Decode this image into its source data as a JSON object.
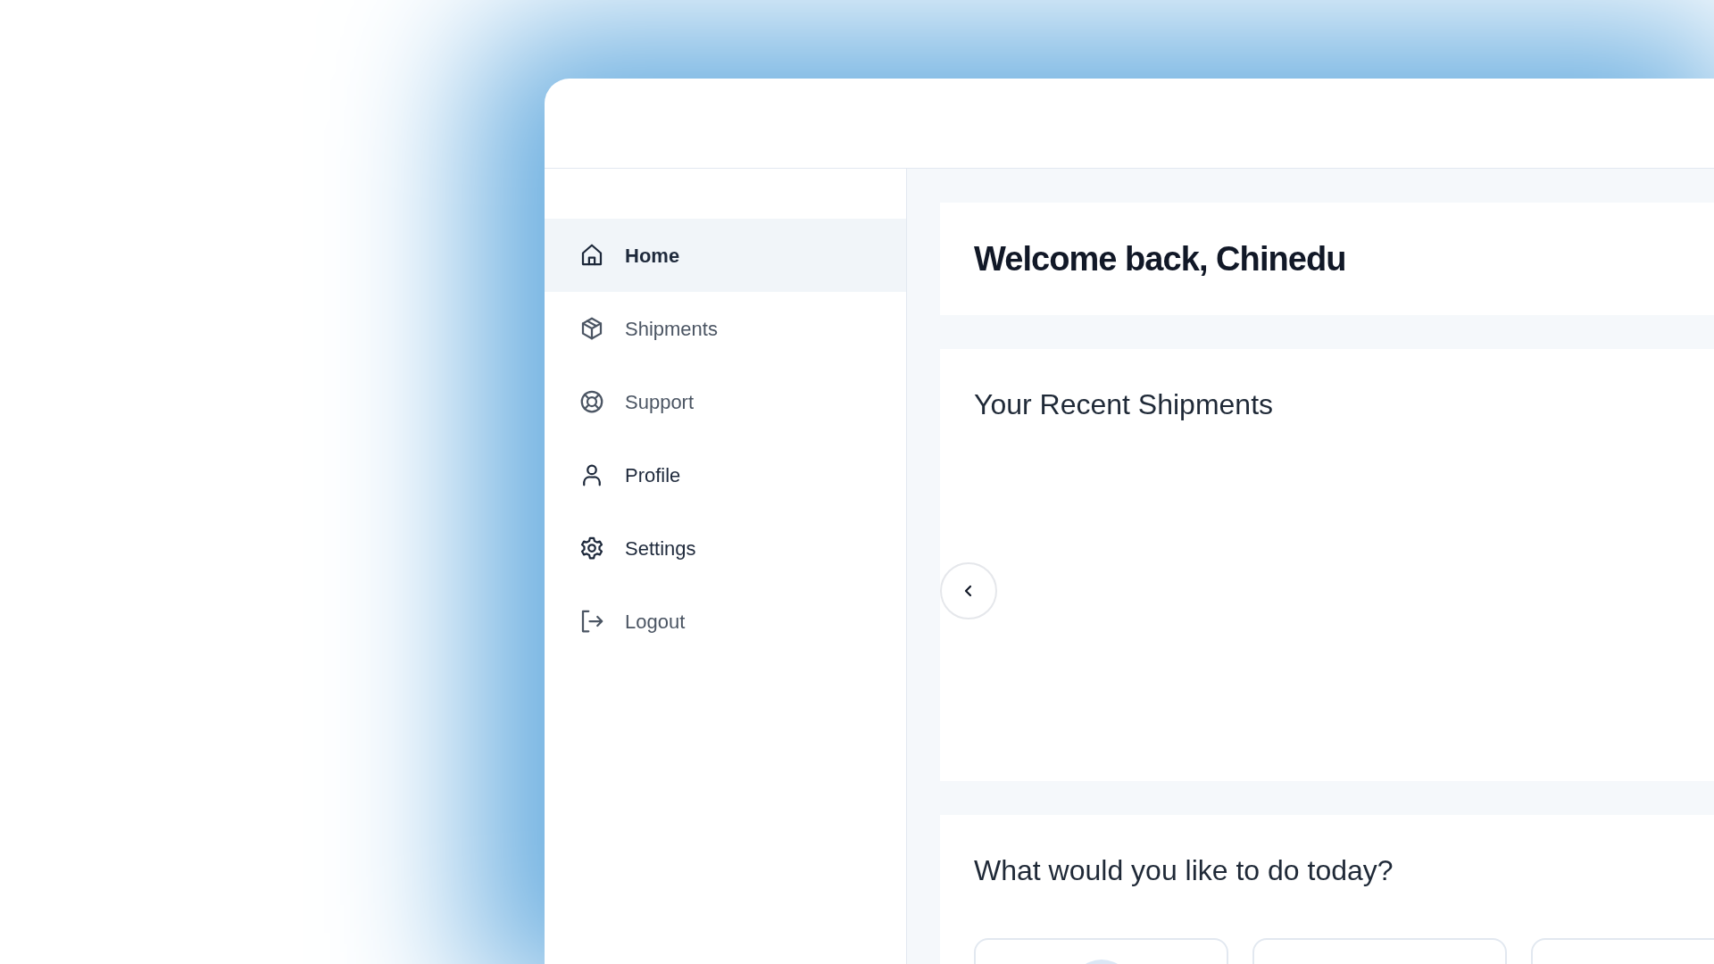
{
  "sidebar": {
    "items": [
      {
        "label": "Home",
        "kind": "home",
        "selected": true,
        "muted": false
      },
      {
        "label": "Shipments",
        "kind": "box",
        "selected": false,
        "muted": true
      },
      {
        "label": "Support",
        "kind": "lifebuoy",
        "selected": false,
        "muted": true
      },
      {
        "label": "Profile",
        "kind": "user",
        "selected": false,
        "muted": false
      },
      {
        "label": "Settings",
        "kind": "gear",
        "selected": false,
        "muted": false
      },
      {
        "label": "Logout",
        "kind": "logout",
        "selected": false,
        "muted": true
      }
    ]
  },
  "welcome": {
    "title": "Welcome back, Chinedu"
  },
  "recent_shipments": {
    "title": "Your Recent Shipments"
  },
  "actions": {
    "title": "What would you like to do today?",
    "cards": [
      {
        "has_icon": true
      },
      {
        "has_icon": false
      },
      {
        "has_icon": false
      }
    ]
  }
}
